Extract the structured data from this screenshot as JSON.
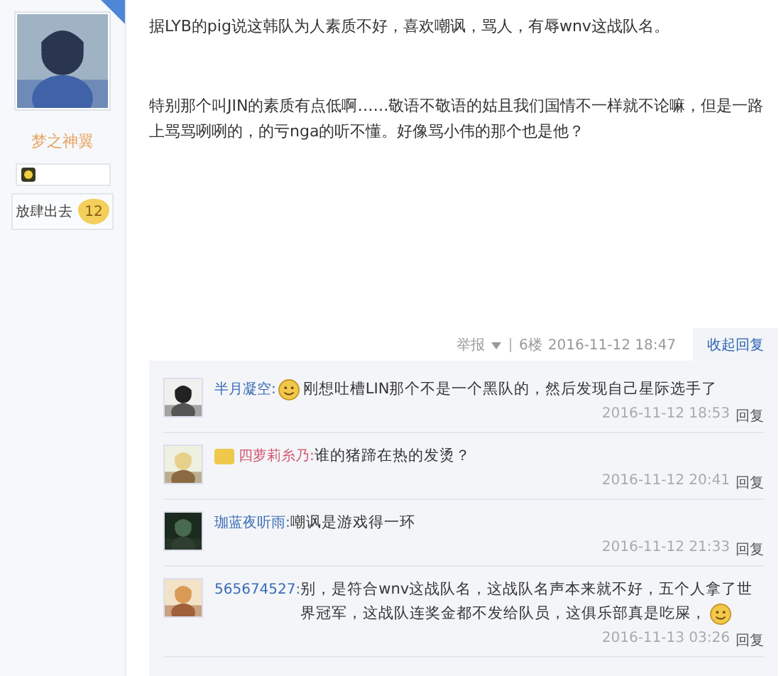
{
  "user": {
    "name": "梦之神翼",
    "title": "放肆出去",
    "level": "12"
  },
  "post": {
    "paragraphs": [
      "据LYB的pig说这韩队为人素质不好，喜欢嘲讽，骂人，有辱wnv这战队名。",
      "特别那个叫JIN的素质有点低啊……敬语不敬语的姑且我们国情不一样就不论嘛，但是一路上骂骂咧咧的，的亏nga的听不懂。好像骂小伟的那个也是他？"
    ],
    "report": "举报",
    "floor": "6楼",
    "time": "2016-11-12 18:47",
    "toggle": "收起回复"
  },
  "replies": [
    {
      "author": "半月凝空:",
      "color": "#3a6bb5",
      "badge_before_name": false,
      "emoji_before_text": true,
      "emoji_after_text": false,
      "text": "刚想吐槽LIN那个不是一个黑队的，然后发现自己星际选手了",
      "time": "2016-11-12 18:53",
      "action": "回复"
    },
    {
      "author": "四萝莉糸乃:",
      "color": "#d4566e",
      "badge_before_name": true,
      "emoji_before_text": false,
      "emoji_after_text": false,
      "text": "谁的猪蹄在热的发烫？",
      "time": "2016-11-12 20:41",
      "action": "回复"
    },
    {
      "author": "珈蓝夜听雨:",
      "color": "#3a6bb5",
      "badge_before_name": false,
      "emoji_before_text": false,
      "emoji_after_text": false,
      "text": "嘲讽是游戏得一环",
      "time": "2016-11-12 21:33",
      "action": "回复"
    },
    {
      "author": "565674527:",
      "color": "#3a6bb5",
      "badge_before_name": false,
      "emoji_before_text": false,
      "emoji_after_text": true,
      "text": "别，是符合wnv这战队名，这战队名声本来就不好，五个人拿了世界冠军，这战队连奖金都不发给队员，这俱乐部真是吃屎，",
      "time": "2016-11-13 03:26",
      "action": "回复"
    }
  ]
}
